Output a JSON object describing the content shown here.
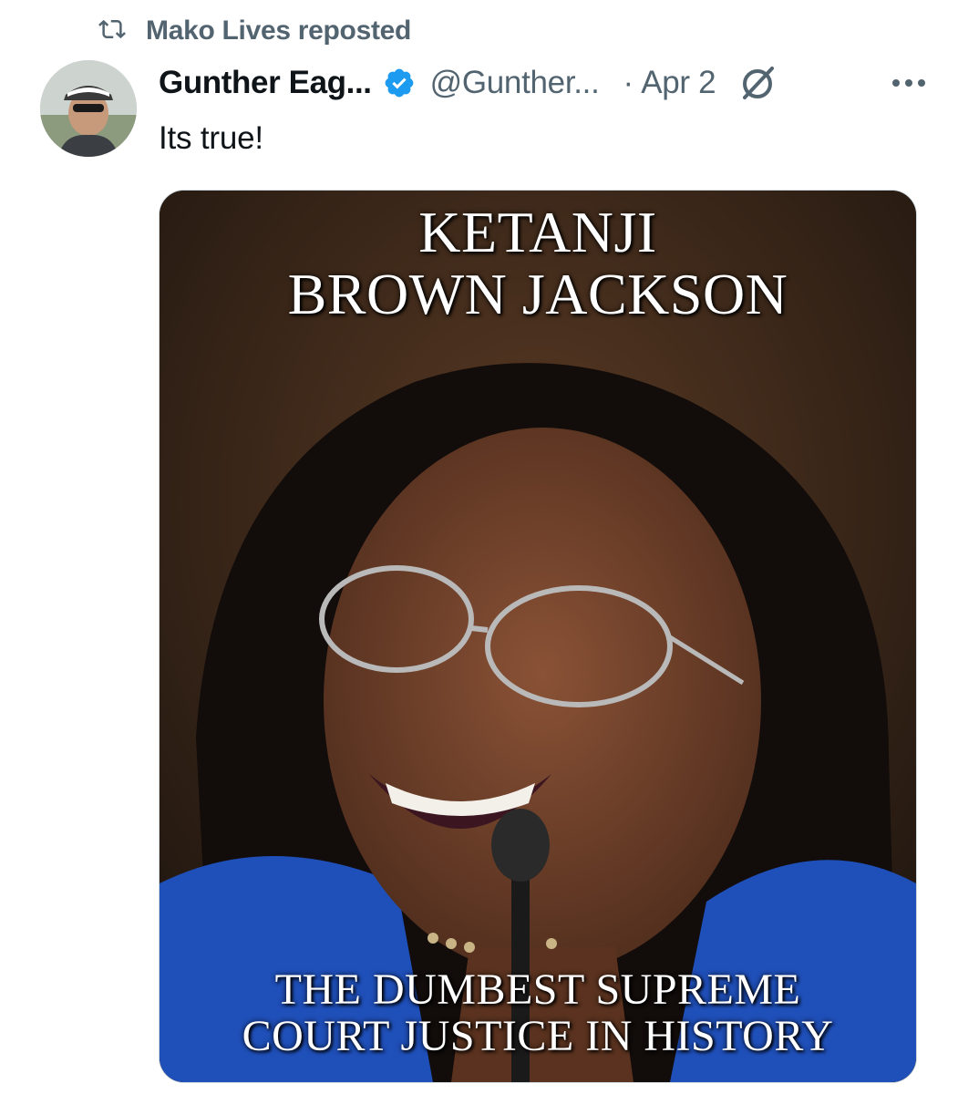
{
  "repost": {
    "icon": "repost-icon",
    "text": "Mako Lives reposted"
  },
  "post": {
    "author_name": "Gunther Eag...",
    "handle": "@Gunther...",
    "separator": "·",
    "timestamp": "Apr 2",
    "verified_icon": "verified-badge-icon",
    "grok_icon": "grok-icon",
    "more_icon": "more-options-icon",
    "text": "Its true!",
    "media": {
      "caption_top_line1": "KETANJI",
      "caption_top_line2": "BROWN JACKSON",
      "caption_bottom_line1": "THE DUMBEST SUPREME",
      "caption_bottom_line2": "COURT JUSTICE IN HISTORY"
    }
  },
  "colors": {
    "text_primary": "#0f1419",
    "text_secondary": "#536471",
    "verified_blue": "#1d9bf0",
    "border": "#cfd9de"
  }
}
